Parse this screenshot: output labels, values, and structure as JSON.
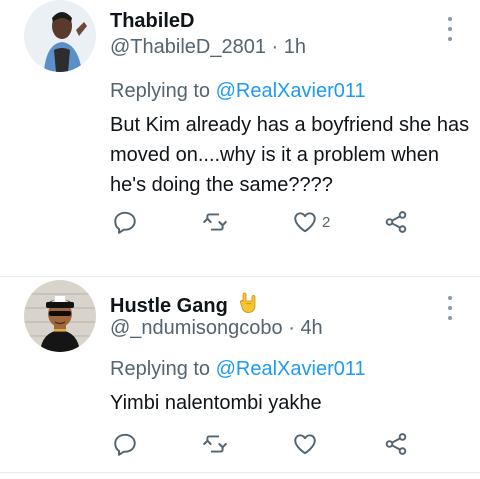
{
  "tweets": [
    {
      "name": "ThabileD",
      "handle": "@ThabileD_2801",
      "time": "1h",
      "replying_prefix": "Replying to",
      "replying_to": "@RealXavier011",
      "text": "But Kim already has a boyfriend she has moved on....why is it a problem when he's doing the same????",
      "likes": "2"
    },
    {
      "name": "Hustle Gang",
      "handle": "@_ndumisongcobo",
      "time": "4h",
      "replying_prefix": "Replying to",
      "replying_to": "@RealXavier011",
      "text": "Yimbi nalentombi yakhe",
      "likes": ""
    }
  ],
  "separator": "·",
  "icons": [
    "reply-icon",
    "retweet-icon",
    "like-icon",
    "share-icon",
    "more-options-icon",
    "rock-on-hand-emoji"
  ],
  "colors": {
    "link": "#1d9bf0",
    "secondary_text": "#536471",
    "primary_text": "#0f1419"
  }
}
